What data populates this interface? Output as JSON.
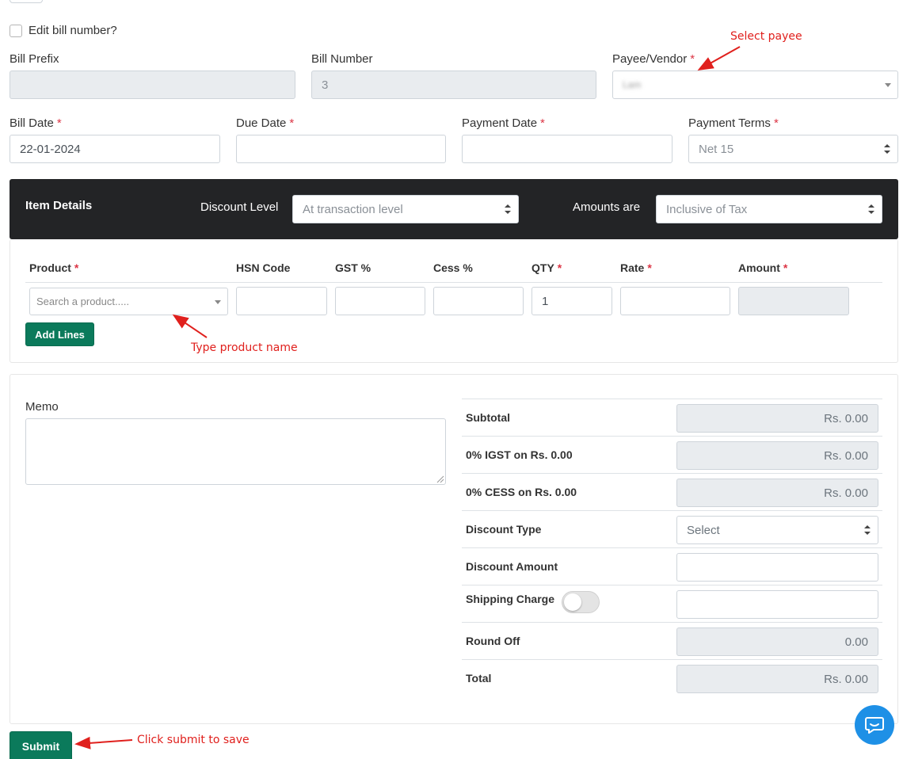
{
  "top": {
    "edit_bill_number_label": "Edit bill number?"
  },
  "fields": {
    "bill_prefix_label": "Bill Prefix",
    "bill_prefix_value": "",
    "bill_number_label": "Bill Number",
    "bill_number_value": "3",
    "payee_label": "Payee/Vendor",
    "payee_value": "Lam",
    "bill_date_label": "Bill Date",
    "bill_date_value": "22-01-2024",
    "due_date_label": "Due Date",
    "due_date_value": "",
    "payment_date_label": "Payment Date",
    "payment_date_value": "",
    "payment_terms_label": "Payment Terms",
    "payment_terms_value": "Net 15",
    "required_mark": "*"
  },
  "item_details": {
    "title": "Item Details",
    "discount_level_label": "Discount Level",
    "discount_level_value": "At transaction level",
    "amounts_are_label": "Amounts are",
    "amounts_are_value": "Inclusive of Tax"
  },
  "table": {
    "headers": [
      "Product",
      "HSN Code",
      "GST %",
      "Cess %",
      "QTY",
      "Rate",
      "Amount"
    ],
    "product_placeholder": "Search a product.....",
    "qty_value": "1",
    "add_lines_label": "Add Lines"
  },
  "memo": {
    "label": "Memo"
  },
  "summary": {
    "rows": [
      {
        "label": "Subtotal",
        "value": "Rs. 0.00"
      },
      {
        "label": "0% IGST on Rs. 0.00",
        "value": "Rs. 0.00"
      },
      {
        "label": "0% CESS on Rs. 0.00",
        "value": "Rs. 0.00"
      },
      {
        "label": "Discount Type",
        "value": "Select"
      },
      {
        "label": "Discount Amount",
        "value": ""
      },
      {
        "label": "Shipping Charge",
        "value": ""
      },
      {
        "label": "Round Off",
        "value": "0.00"
      },
      {
        "label": "Total",
        "value": "Rs. 0.00"
      }
    ]
  },
  "submit_label": "Submit",
  "annotations": {
    "select_payee": "Select payee",
    "type_product": "Type product name",
    "click_submit": "Click submit to save"
  },
  "colors": {
    "primary_green": "#0b7a5b",
    "dark_bar": "#232426",
    "annotation_red": "#e0201d",
    "chat_blue": "#1e90e6"
  }
}
